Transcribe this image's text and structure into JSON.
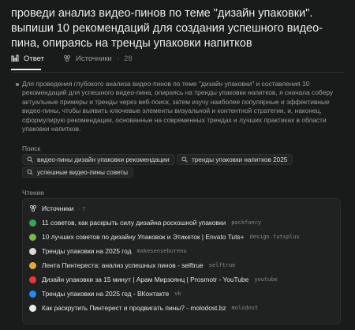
{
  "question": "проведи анализ видео-пинов по теме \"дизайн упаковки\". выпиши 10 рекомендаций для создания успешного видео-пина, опираясь на тренды упаковки напитков",
  "tabs": [
    {
      "label": "Ответ",
      "icon": "answer-icon",
      "active": true
    },
    {
      "label": "Источники",
      "count": "28",
      "icon": "sources-icon",
      "active": false
    }
  ],
  "reasoning_text": "Для проведения глубокого анализа видео-пинов по теме \"дизайн упаковки\" и составления 10 рекомендаций для успешного видео-пина, опираясь на тренды упаковки напитков, я сначала соберу актуальные примеры и тренды через веб-поиск, затем изучу наиболее популярные и эффективные видео-пины, чтобы выявить ключевые элементы визуальной и контентной стратегии, и, наконец, сформулирую рекомендации, основанные на современных трендах и лучших практиках в области упаковки напитков.",
  "search": {
    "label": "Поиск",
    "queries": [
      "видео-пины дизайн упаковки рекомендации",
      "тренды упаковки напитков 2025",
      "успешные видео-пины советы"
    ]
  },
  "reading": {
    "label": "Чтение",
    "header": "Источники",
    "count": "· 7",
    "sources": [
      {
        "title": "11 советов, как раскрыть силу дизайна роскошной упаковки",
        "domain": "packfancy",
        "color": "#3aa35a"
      },
      {
        "title": "10 лучших советов по дизайну Упаковок и Этикеток | Envato Tuts+",
        "domain": "design.tutsplus",
        "color": "#7ab648"
      },
      {
        "title": "Тренды упаковки на 2025 год",
        "domain": "makesenseburenu",
        "color": "#d9d9d9"
      },
      {
        "title": "Лента Пинтереста: анализ успешных пинов - selftrue",
        "domain": "selftrue",
        "color": "#e0a93a"
      },
      {
        "title": "Дизайн упаковки за 15 минут | Арам Мирзоянц | Prosmotr - YouTube",
        "domain": "youtube",
        "color": "#e53935"
      },
      {
        "title": "Тренды упаковки на 2025 год - ВКонтакте",
        "domain": "vk",
        "color": "#2787f5"
      },
      {
        "title": "Как раскрутить Пинтерест и продвигать пины? - molodost.bz",
        "domain": "molodost",
        "color": "#e9e9e9"
      }
    ]
  }
}
